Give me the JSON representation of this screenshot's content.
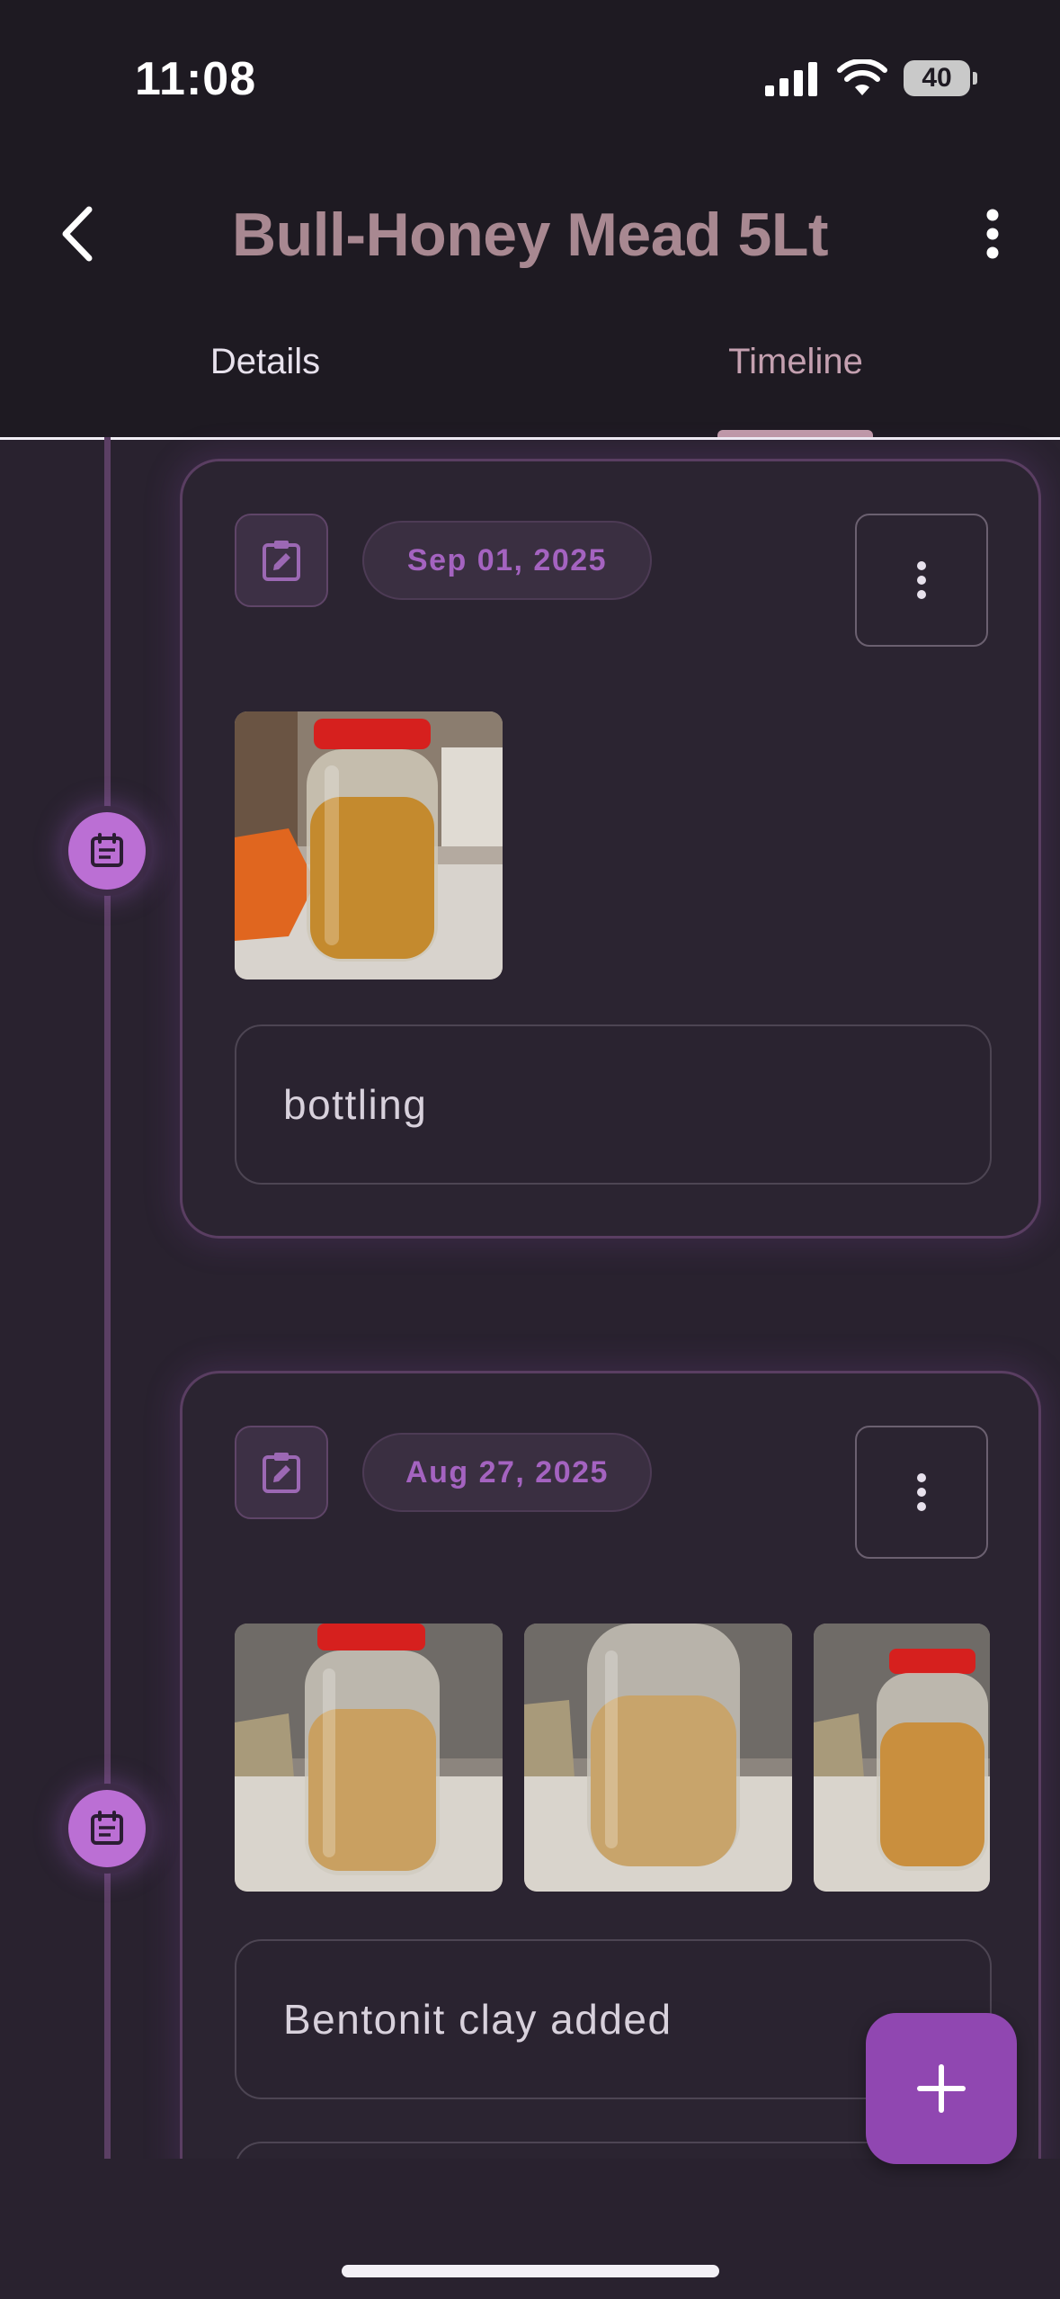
{
  "status_bar": {
    "time": "11:08",
    "battery": "40"
  },
  "app_bar": {
    "title": "Bull-Honey Mead 5Lt",
    "back_icon": "chevron-left-icon",
    "menu_icon": "more-vertical-icon"
  },
  "tabs": [
    {
      "label": "Details",
      "selected": false
    },
    {
      "label": "Timeline",
      "selected": true
    }
  ],
  "timeline": {
    "entries": [
      {
        "date": "Sep 01, 2025",
        "note": "bottling",
        "photos": [
          "jar-amber-on-table-with-orange-bag"
        ]
      },
      {
        "date": "Aug 27, 2025",
        "note": "Bentonit clay added",
        "photos": [
          "jar-cloudy-mead-1",
          "jar-cloudy-mead-2",
          "jar-cloudy-mead-3"
        ]
      }
    ]
  },
  "fab": {
    "icon": "plus-icon"
  },
  "colors": {
    "accent": "#9047b1",
    "title": "#a88891",
    "node": "#bb6fd4",
    "background": "#29222f"
  }
}
